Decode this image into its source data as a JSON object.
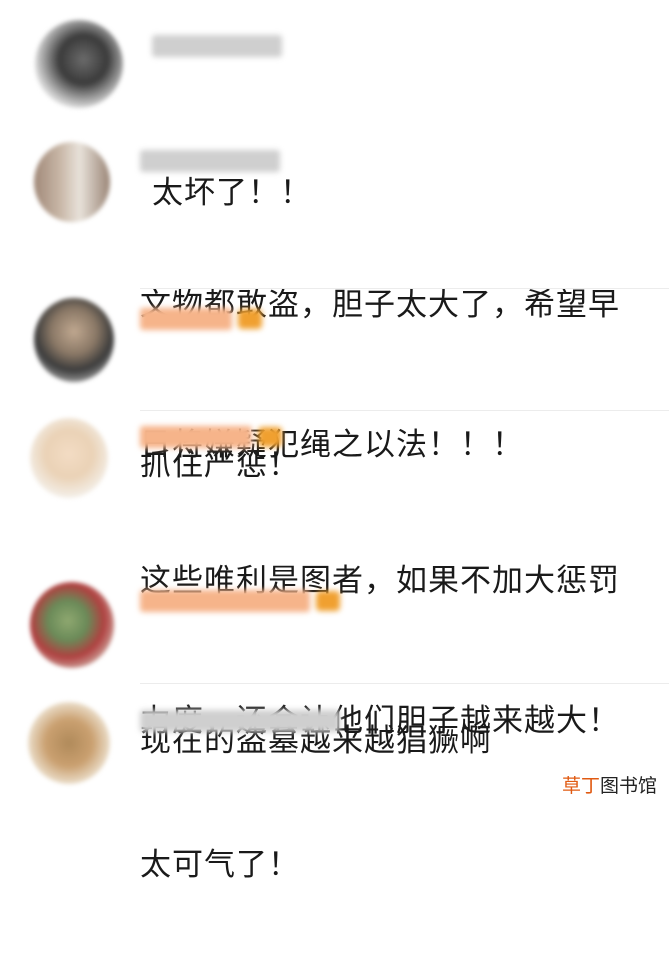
{
  "comments": [
    {
      "username": "",
      "text_lines": [
        "太坏了！！"
      ]
    },
    {
      "username": "",
      "text_lines": [
        "文物都敢盗，胆子太大了，希望早",
        "日将嫌疑犯绳之以法！！！"
      ]
    },
    {
      "username": "",
      "text_lines": [
        "抓住严惩！"
      ]
    },
    {
      "username": "",
      "text_lines": [
        "这些唯利是图者，如果不加大惩罚",
        "力度，还会让他们胆子越来越大！"
      ]
    },
    {
      "username": "",
      "text_lines": [
        "现在的盗墓越来越猖獗啊"
      ]
    },
    {
      "username": "",
      "text_lines": [
        "太可气了！"
      ]
    }
  ],
  "watermark": {
    "accent": "草丁",
    "rest": "图书馆"
  },
  "colors": {
    "text": "#1a1a1a",
    "username_blur": "#d8d8d8",
    "username_orange": "#f6b48a",
    "crown": "#f0a030",
    "watermark_accent": "#e05a12"
  }
}
